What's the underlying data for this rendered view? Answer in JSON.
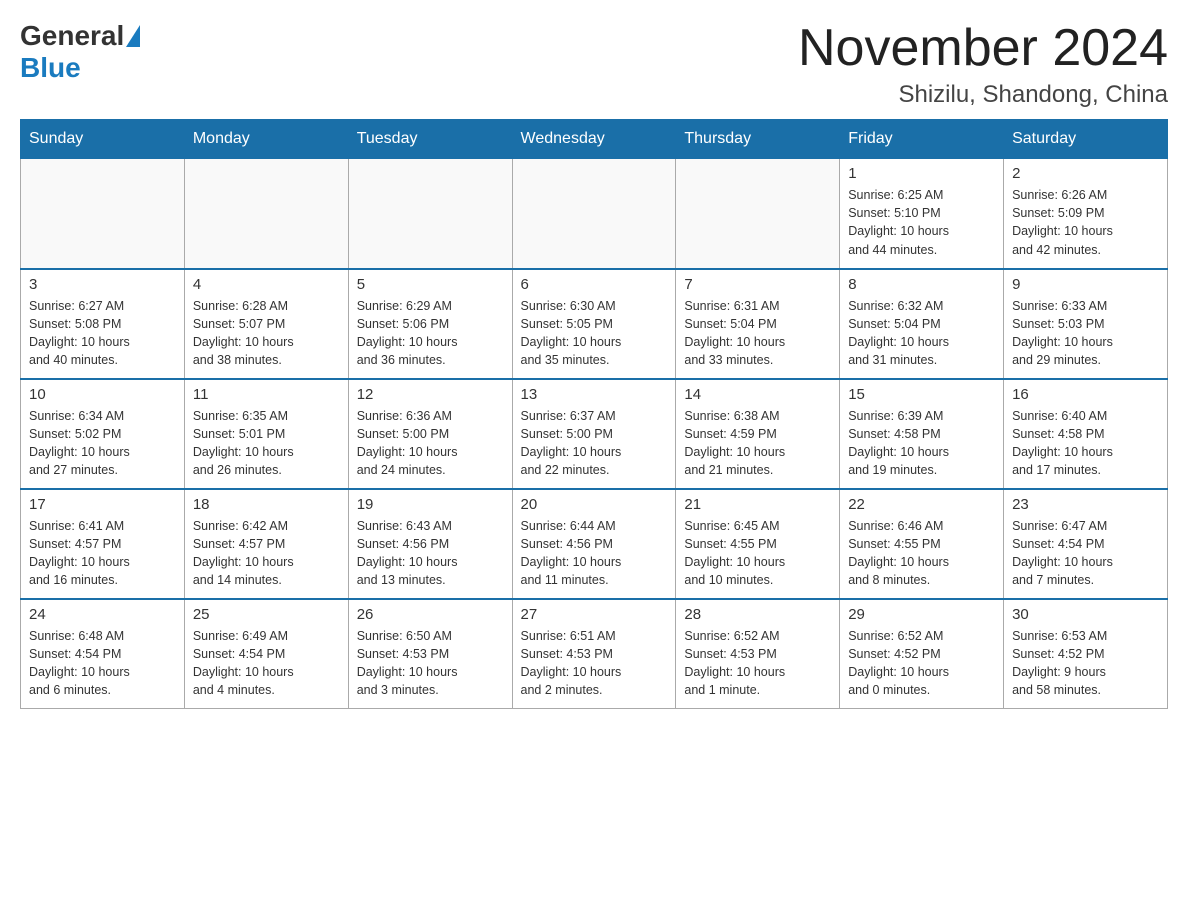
{
  "header": {
    "logo_general": "General",
    "logo_blue": "Blue",
    "month": "November 2024",
    "location": "Shizilu, Shandong, China"
  },
  "days_of_week": [
    "Sunday",
    "Monday",
    "Tuesday",
    "Wednesday",
    "Thursday",
    "Friday",
    "Saturday"
  ],
  "weeks": [
    [
      {
        "day": "",
        "info": ""
      },
      {
        "day": "",
        "info": ""
      },
      {
        "day": "",
        "info": ""
      },
      {
        "day": "",
        "info": ""
      },
      {
        "day": "",
        "info": ""
      },
      {
        "day": "1",
        "info": "Sunrise: 6:25 AM\nSunset: 5:10 PM\nDaylight: 10 hours\nand 44 minutes."
      },
      {
        "day": "2",
        "info": "Sunrise: 6:26 AM\nSunset: 5:09 PM\nDaylight: 10 hours\nand 42 minutes."
      }
    ],
    [
      {
        "day": "3",
        "info": "Sunrise: 6:27 AM\nSunset: 5:08 PM\nDaylight: 10 hours\nand 40 minutes."
      },
      {
        "day": "4",
        "info": "Sunrise: 6:28 AM\nSunset: 5:07 PM\nDaylight: 10 hours\nand 38 minutes."
      },
      {
        "day": "5",
        "info": "Sunrise: 6:29 AM\nSunset: 5:06 PM\nDaylight: 10 hours\nand 36 minutes."
      },
      {
        "day": "6",
        "info": "Sunrise: 6:30 AM\nSunset: 5:05 PM\nDaylight: 10 hours\nand 35 minutes."
      },
      {
        "day": "7",
        "info": "Sunrise: 6:31 AM\nSunset: 5:04 PM\nDaylight: 10 hours\nand 33 minutes."
      },
      {
        "day": "8",
        "info": "Sunrise: 6:32 AM\nSunset: 5:04 PM\nDaylight: 10 hours\nand 31 minutes."
      },
      {
        "day": "9",
        "info": "Sunrise: 6:33 AM\nSunset: 5:03 PM\nDaylight: 10 hours\nand 29 minutes."
      }
    ],
    [
      {
        "day": "10",
        "info": "Sunrise: 6:34 AM\nSunset: 5:02 PM\nDaylight: 10 hours\nand 27 minutes."
      },
      {
        "day": "11",
        "info": "Sunrise: 6:35 AM\nSunset: 5:01 PM\nDaylight: 10 hours\nand 26 minutes."
      },
      {
        "day": "12",
        "info": "Sunrise: 6:36 AM\nSunset: 5:00 PM\nDaylight: 10 hours\nand 24 minutes."
      },
      {
        "day": "13",
        "info": "Sunrise: 6:37 AM\nSunset: 5:00 PM\nDaylight: 10 hours\nand 22 minutes."
      },
      {
        "day": "14",
        "info": "Sunrise: 6:38 AM\nSunset: 4:59 PM\nDaylight: 10 hours\nand 21 minutes."
      },
      {
        "day": "15",
        "info": "Sunrise: 6:39 AM\nSunset: 4:58 PM\nDaylight: 10 hours\nand 19 minutes."
      },
      {
        "day": "16",
        "info": "Sunrise: 6:40 AM\nSunset: 4:58 PM\nDaylight: 10 hours\nand 17 minutes."
      }
    ],
    [
      {
        "day": "17",
        "info": "Sunrise: 6:41 AM\nSunset: 4:57 PM\nDaylight: 10 hours\nand 16 minutes."
      },
      {
        "day": "18",
        "info": "Sunrise: 6:42 AM\nSunset: 4:57 PM\nDaylight: 10 hours\nand 14 minutes."
      },
      {
        "day": "19",
        "info": "Sunrise: 6:43 AM\nSunset: 4:56 PM\nDaylight: 10 hours\nand 13 minutes."
      },
      {
        "day": "20",
        "info": "Sunrise: 6:44 AM\nSunset: 4:56 PM\nDaylight: 10 hours\nand 11 minutes."
      },
      {
        "day": "21",
        "info": "Sunrise: 6:45 AM\nSunset: 4:55 PM\nDaylight: 10 hours\nand 10 minutes."
      },
      {
        "day": "22",
        "info": "Sunrise: 6:46 AM\nSunset: 4:55 PM\nDaylight: 10 hours\nand 8 minutes."
      },
      {
        "day": "23",
        "info": "Sunrise: 6:47 AM\nSunset: 4:54 PM\nDaylight: 10 hours\nand 7 minutes."
      }
    ],
    [
      {
        "day": "24",
        "info": "Sunrise: 6:48 AM\nSunset: 4:54 PM\nDaylight: 10 hours\nand 6 minutes."
      },
      {
        "day": "25",
        "info": "Sunrise: 6:49 AM\nSunset: 4:54 PM\nDaylight: 10 hours\nand 4 minutes."
      },
      {
        "day": "26",
        "info": "Sunrise: 6:50 AM\nSunset: 4:53 PM\nDaylight: 10 hours\nand 3 minutes."
      },
      {
        "day": "27",
        "info": "Sunrise: 6:51 AM\nSunset: 4:53 PM\nDaylight: 10 hours\nand 2 minutes."
      },
      {
        "day": "28",
        "info": "Sunrise: 6:52 AM\nSunset: 4:53 PM\nDaylight: 10 hours\nand 1 minute."
      },
      {
        "day": "29",
        "info": "Sunrise: 6:52 AM\nSunset: 4:52 PM\nDaylight: 10 hours\nand 0 minutes."
      },
      {
        "day": "30",
        "info": "Sunrise: 6:53 AM\nSunset: 4:52 PM\nDaylight: 9 hours\nand 58 minutes."
      }
    ]
  ]
}
